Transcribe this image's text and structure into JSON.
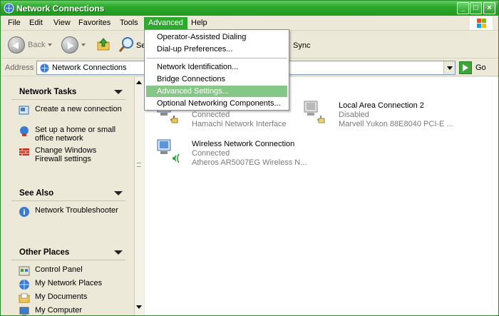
{
  "window": {
    "title": "Network Connections"
  },
  "menubar": {
    "items": [
      "File",
      "Edit",
      "View",
      "Favorites",
      "Tools",
      "Advanced",
      "Help"
    ],
    "active": "Advanced"
  },
  "toolbar": {
    "back_label": "Back",
    "search_label": "Se",
    "sync_label": "Sync"
  },
  "address": {
    "label": "Address",
    "value": "Network Connections",
    "go_label": "Go"
  },
  "advanced_menu": {
    "items": [
      "Operator-Assisted Dialing",
      "Dial-up Preferences...",
      "Network Identification...",
      "Bridge Connections",
      "Advanced Settings...",
      "Optional Networking Components..."
    ],
    "highlighted": "Advanced Settings..."
  },
  "sidebar": {
    "network_tasks": {
      "title": "Network Tasks",
      "items": [
        "Create a new connection",
        "Set up a home or small office network",
        "Change Windows Firewall settings"
      ]
    },
    "see_also": {
      "title": "See Also",
      "items": [
        "Network Troubleshooter"
      ]
    },
    "other_places": {
      "title": "Other Places",
      "items": [
        "Control Panel",
        "My Network Places",
        "My Documents",
        "My Computer"
      ]
    }
  },
  "connections": [
    {
      "name": "",
      "status": "Connected",
      "device": "Hamachi Network Interface"
    },
    {
      "name": "Local Area Connection 2",
      "status": "Disabled",
      "device": "Marvell Yukon 88E8040 PCI-E ..."
    },
    {
      "name": "Wireless Network Connection",
      "status": "Connected",
      "device": "Atheros AR5007EG Wireless N..."
    }
  ],
  "colors": {
    "titlebar": "#2ea82e",
    "menu_active": "#2ea82e",
    "menu_highlight": "#86c686"
  }
}
